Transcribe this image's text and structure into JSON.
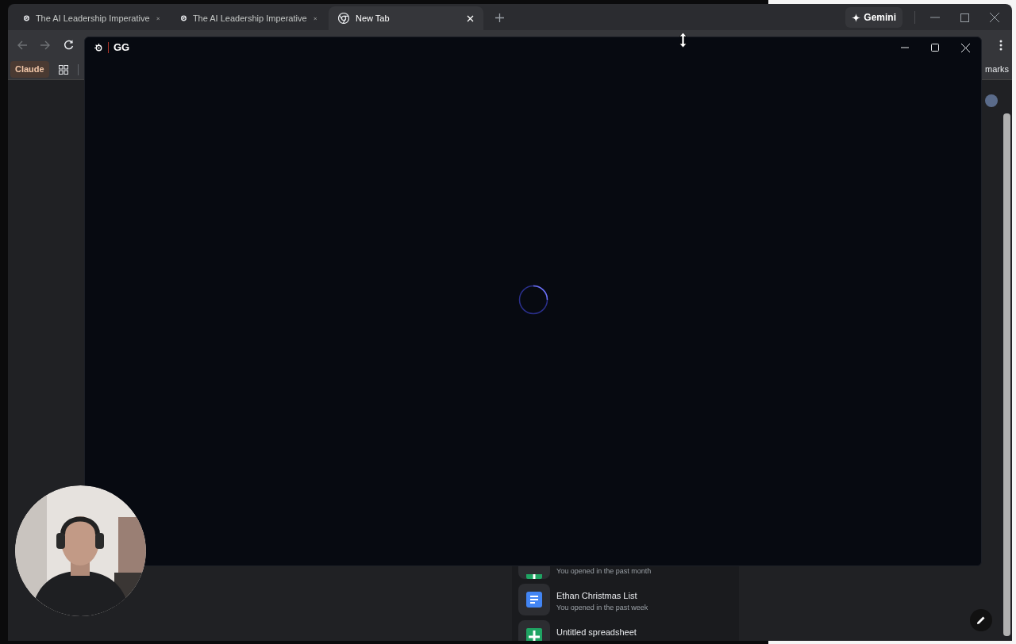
{
  "browser": {
    "tabs": [
      {
        "title": "The AI Leadership Imperative",
        "kind": "site",
        "selected": false
      },
      {
        "title": "The AI Leadership Imperative",
        "kind": "site",
        "selected": false
      },
      {
        "title": "New Tab",
        "kind": "newtab",
        "selected": true
      }
    ],
    "gemini_button": "Gemini",
    "bookmarks": {
      "chip": "Claude",
      "right_label": "marks"
    },
    "drive_items": [
      {
        "kind": "sheet",
        "subtitle": "You opened in the past month"
      },
      {
        "kind": "doc",
        "title": "Ethan Christmas List",
        "subtitle": "You opened in the past week"
      },
      {
        "kind": "sheet",
        "title": "Untitled spreadsheet"
      }
    ]
  },
  "overlay_window": {
    "title": "GG",
    "loading": true
  }
}
